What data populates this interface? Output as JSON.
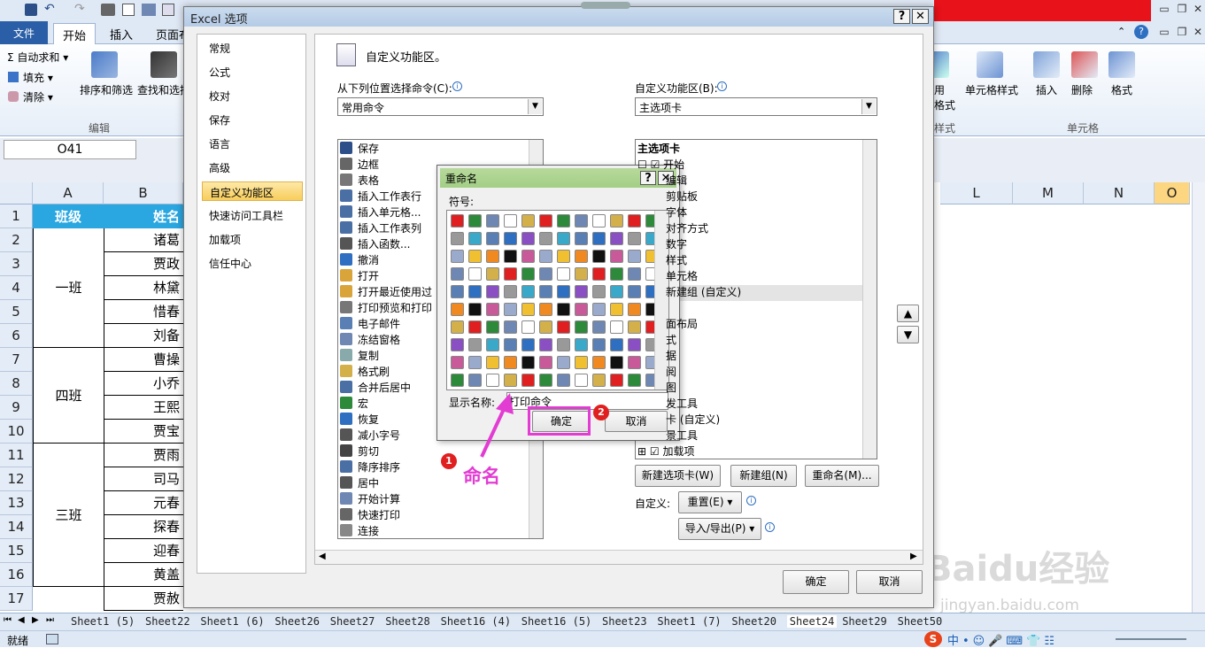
{
  "excel": {
    "file_tab": "文件",
    "tabs": [
      "开始",
      "插入",
      "页面布"
    ],
    "ribbon": {
      "autosum": "Σ 自动求和 ▾",
      "fill": "填充 ▾",
      "clear": "清除 ▾",
      "sort_filter": "排序和筛选",
      "find_select": "查找和选择",
      "edit_group": "编辑",
      "cell_style": "单元格样式",
      "insert": "插入",
      "delete": "删除",
      "format": "格式",
      "cells_group": "单元格",
      "style_group": "样式",
      "cond_frag": "用",
      "table_frag": "格式"
    },
    "name_box": "O41",
    "columns": [
      "A",
      "B",
      "L",
      "M",
      "N",
      "O"
    ],
    "rows": [
      "1",
      "2",
      "3",
      "4",
      "5",
      "6",
      "7",
      "8",
      "9",
      "10",
      "11",
      "12",
      "13",
      "14",
      "15",
      "16",
      "17"
    ],
    "header_row": {
      "a": "班级",
      "b": "姓名"
    },
    "class_groups": [
      "一班",
      "四班",
      "三班"
    ],
    "names": [
      "诸葛",
      "贾政",
      "林黛",
      "惜春",
      "刘备",
      "曹操",
      "小乔",
      "王熙",
      "贾宝",
      "贾雨",
      "司马",
      "元春",
      "探春",
      "迎春",
      "黄盖",
      "贾赦"
    ],
    "sheet_tabs": [
      "Sheet1 (5)",
      "Sheet22",
      "Sheet1 (6)",
      "Sheet26",
      "Sheet27",
      "Sheet28",
      "Sheet16 (4)",
      "Sheet16 (5)",
      "Sheet23",
      "Sheet1 (7)",
      "Sheet20",
      "Sheet24",
      "Sheet29",
      "Sheet50"
    ],
    "status": "就绪"
  },
  "options_dialog": {
    "title": "Excel 选项",
    "nav": [
      "常规",
      "公式",
      "校对",
      "保存",
      "语言",
      "高级",
      "自定义功能区",
      "快速访问工具栏",
      "加载项",
      "信任中心"
    ],
    "selected_nav": "自定义功能区",
    "header": "自定义功能区。",
    "choose_label": "从下列位置选择命令(C):",
    "choose_value": "常用命令",
    "customize_label": "自定义功能区(B):",
    "customize_value": "主选项卡",
    "commands": [
      "保存",
      "边框",
      "表格",
      "插入工作表行",
      "插入单元格...",
      "插入工作表列",
      "插入函数...",
      "撤消",
      "打开",
      "打开最近使用过",
      "打印预览和打印",
      "电子邮件",
      "冻结窗格",
      "复制",
      "格式刷",
      "合并后居中",
      "宏",
      "恢复",
      "减小字号",
      "剪切",
      "降序排序",
      "居中",
      "开始计算",
      "快速打印",
      "连接"
    ],
    "tree_header": "主选项卡",
    "tree_items": [
      "☐ ☑ 开始",
      "编辑",
      "剪贴板",
      "字体",
      "对齐方式",
      "数字",
      "样式",
      "单元格",
      "新建组 (自定义)",
      "",
      "面布局",
      "式",
      "据",
      "阅",
      "图",
      "发工具",
      "卡 (自定义)",
      "景工具",
      "⊞ ☑ 加载项"
    ],
    "new_tab_btn": "新建选项卡(W)",
    "new_group_btn": "新建组(N)",
    "rename_btn": "重命名(M)...",
    "customize_lbl": "自定义:",
    "reset_btn": "重置(E) ▾",
    "import_export_btn": "导入/导出(P) ▾",
    "ok": "确定",
    "cancel": "取消"
  },
  "rename_dialog": {
    "title": "重命名",
    "symbol_label": "符号:",
    "display_label": "显示名称:",
    "display_value": "打印命令",
    "ok": "确定",
    "cancel": "取消"
  },
  "annotations": {
    "step1": "1",
    "step2": "2",
    "caption": "命名",
    "color": "#e23cd3"
  },
  "watermark": {
    "brand": "Baidu经验",
    "url": "jingyan.baidu.com"
  }
}
